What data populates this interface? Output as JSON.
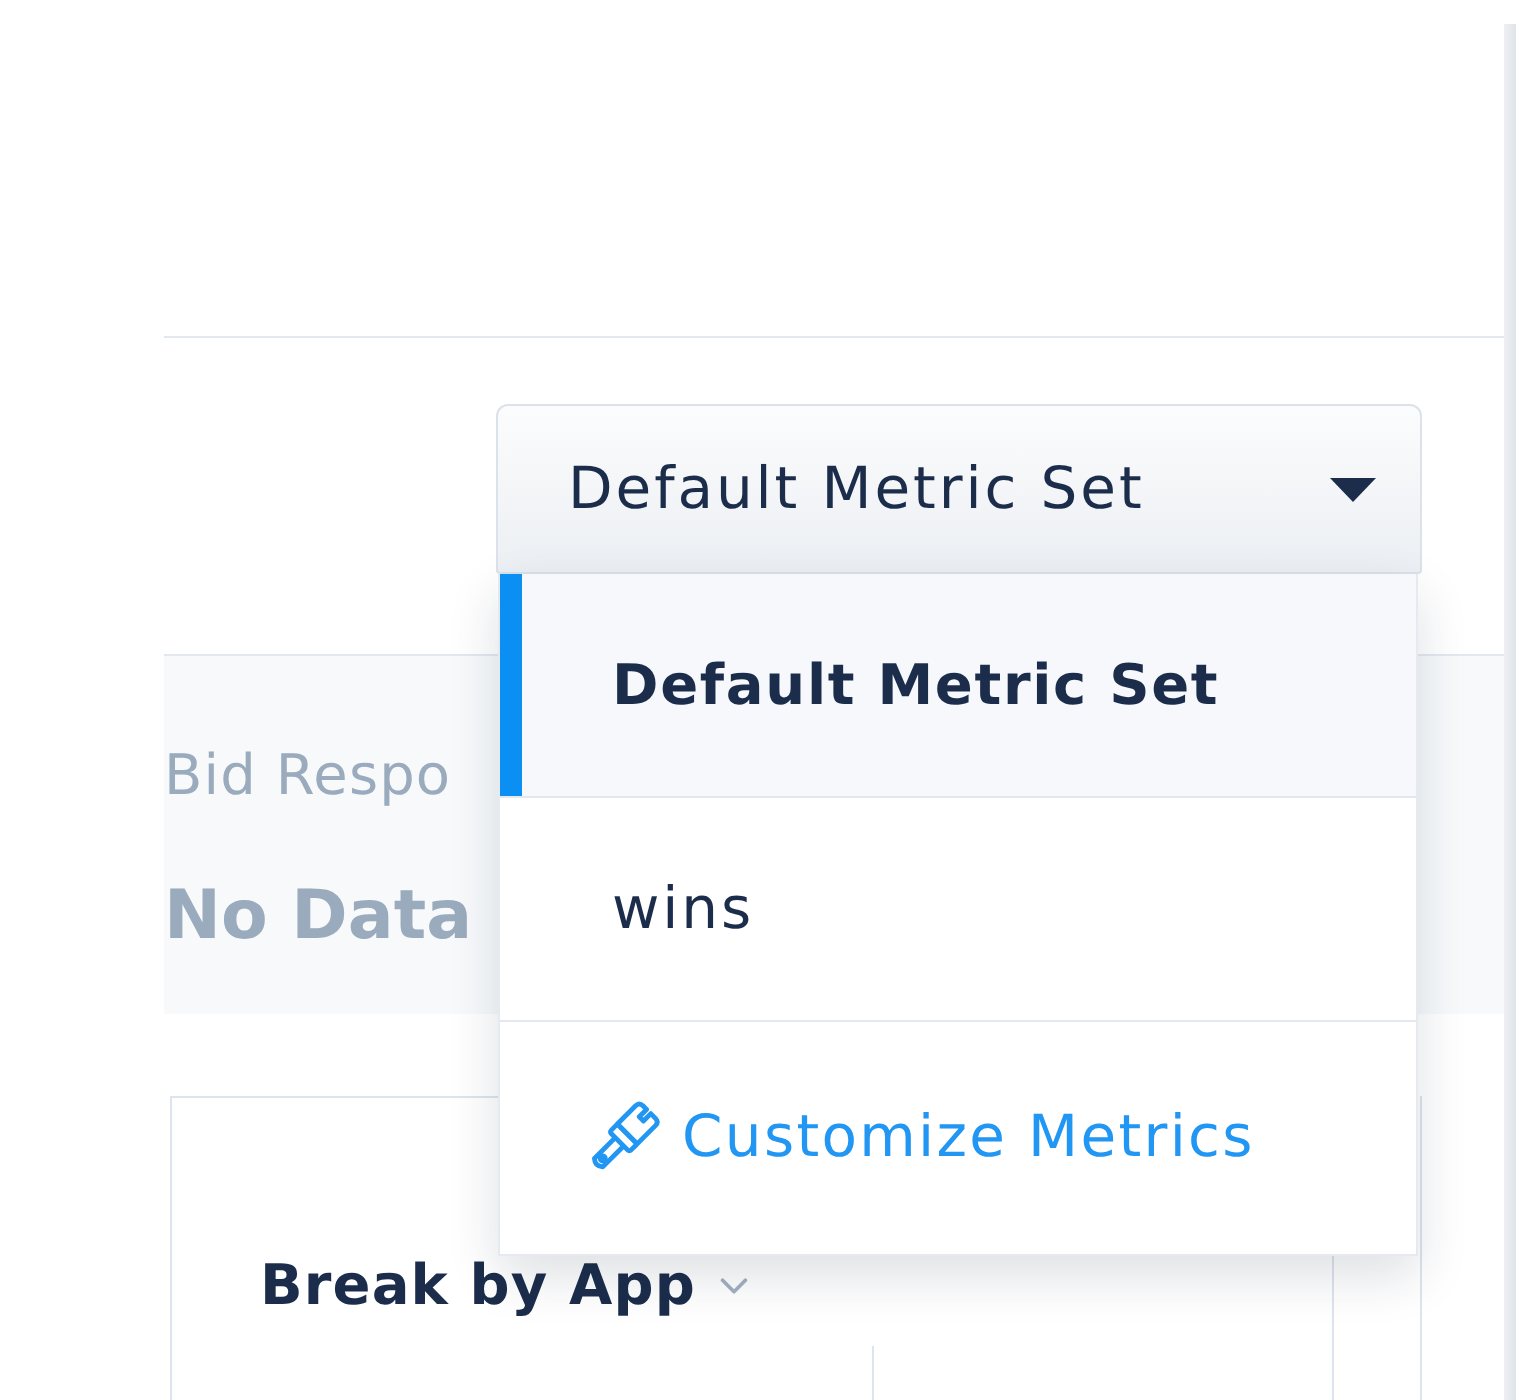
{
  "metric_set_dropdown": {
    "value": "Default Metric Set",
    "expanded": true
  },
  "metric_set_menu": {
    "items": [
      {
        "label": "Default Metric Set",
        "selected": true
      },
      {
        "label": "wins",
        "selected": false
      }
    ],
    "action": {
      "label": "Customize Metrics"
    }
  },
  "summary": {
    "label": "Bid Respo",
    "value": "No Data"
  },
  "breakdown_card": {
    "title": "Break by App"
  }
}
